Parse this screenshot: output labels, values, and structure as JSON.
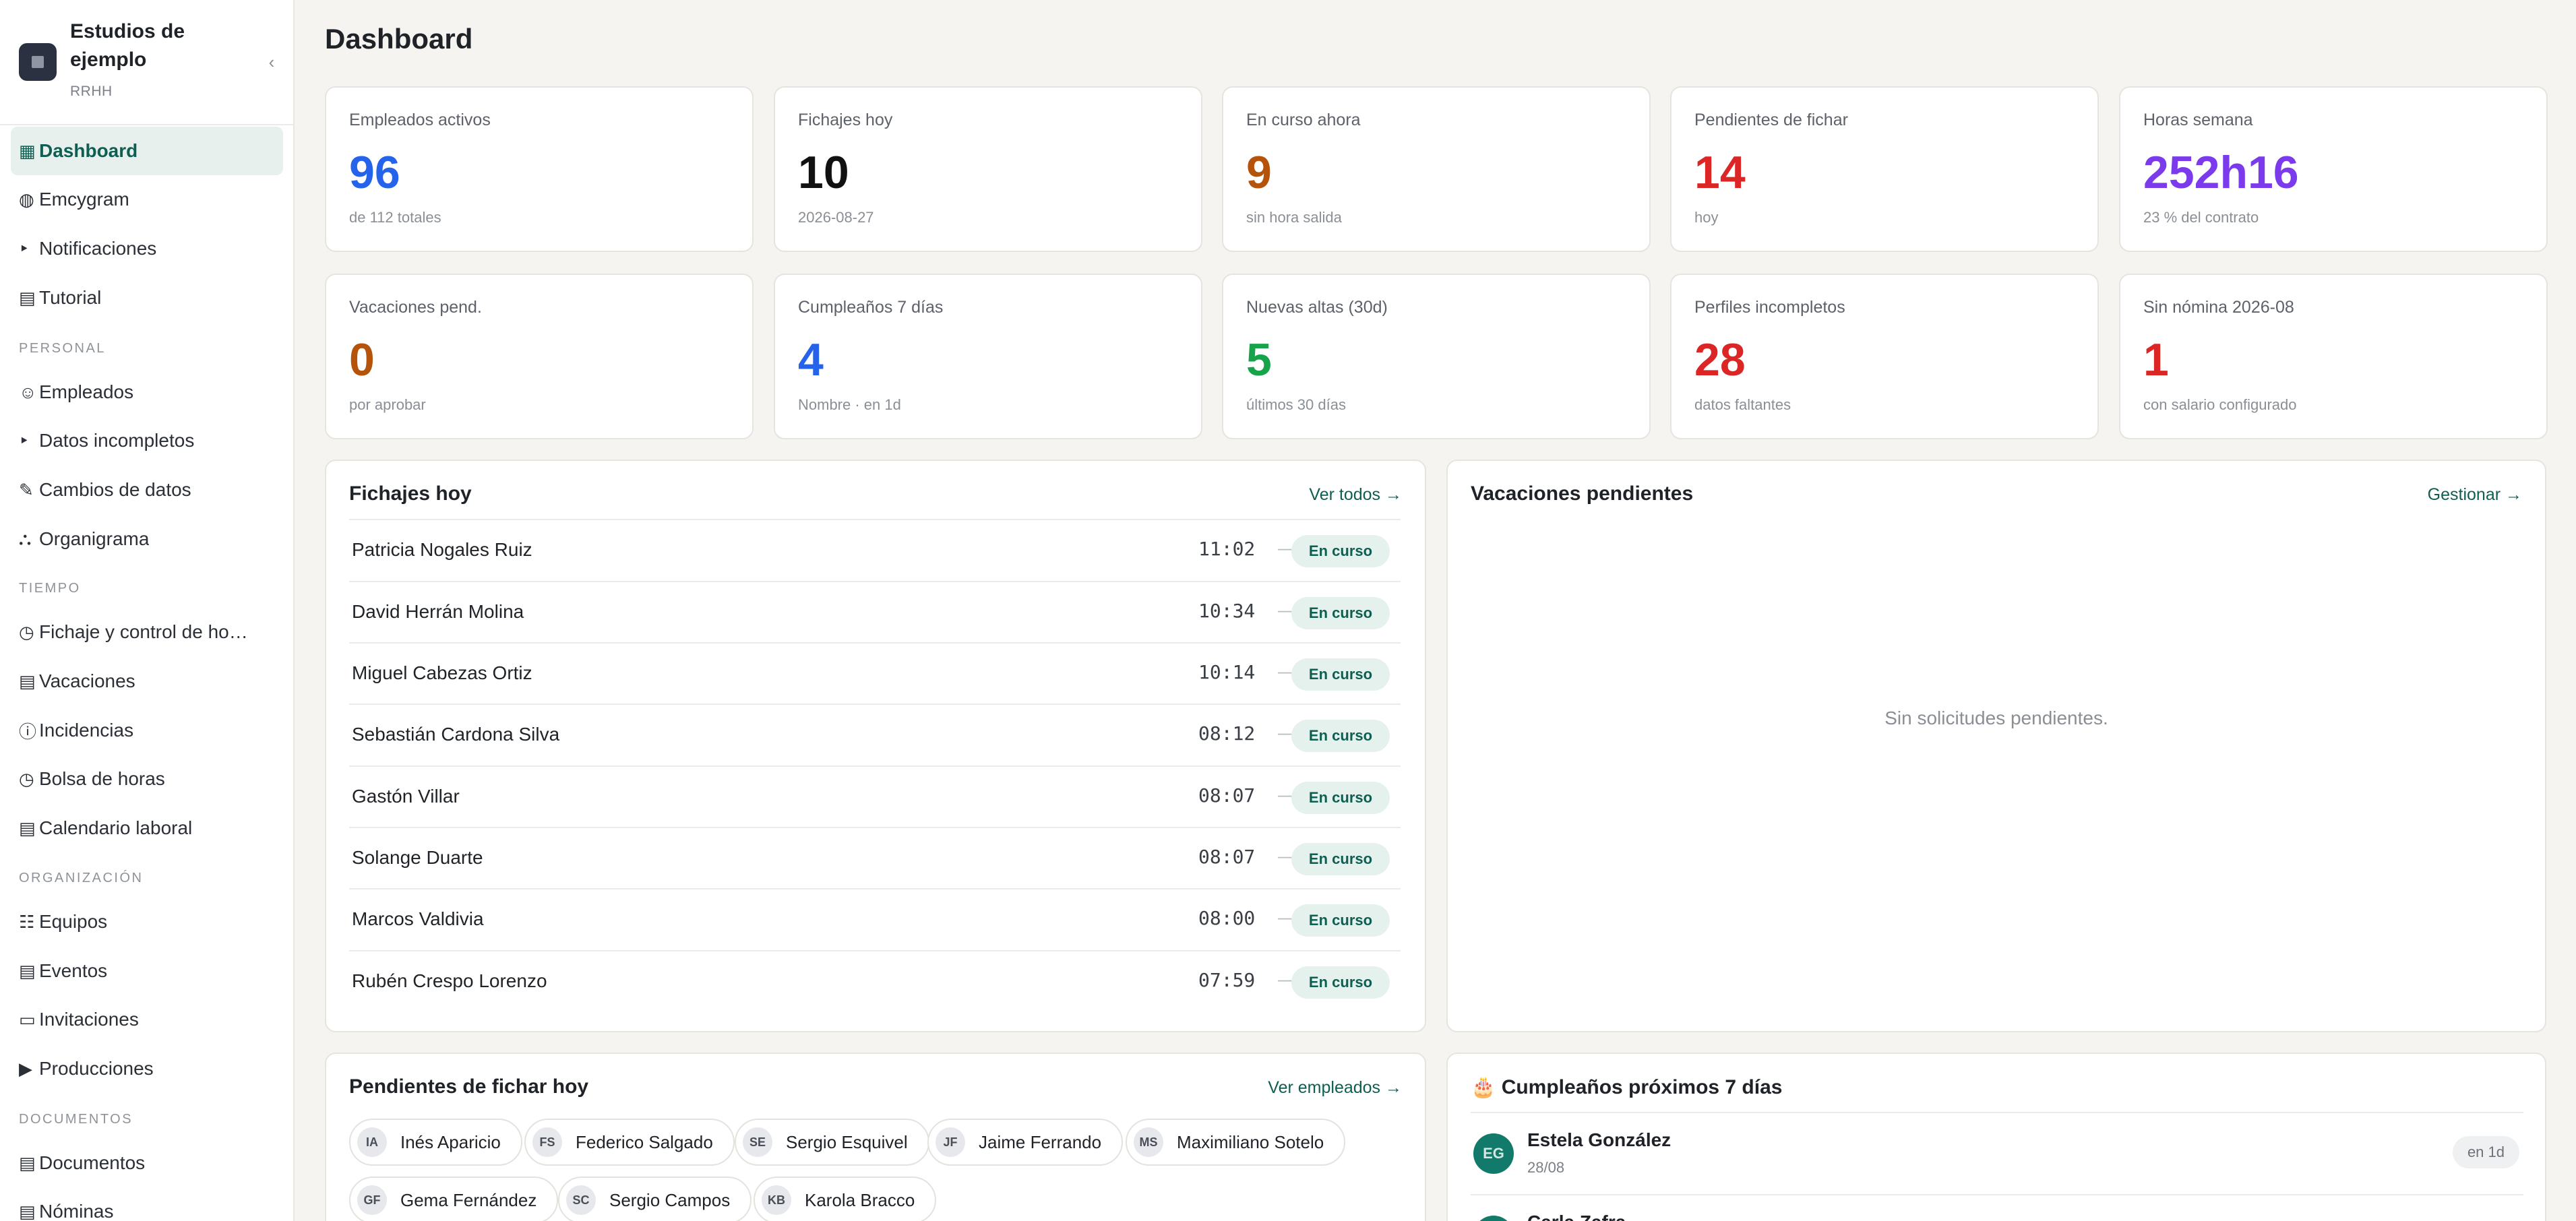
{
  "sidebar": {
    "brand_name": "Estudios de ejemplo",
    "brand_sub": "RRHH",
    "collapse_icon": "chevron-left-icon",
    "items": [
      {
        "icon": "▦",
        "icon_name": "grid-icon",
        "label": "Dashboard",
        "active": true
      },
      {
        "icon": "◍",
        "icon_name": "globe-icon",
        "label": "Emcygram"
      },
      {
        "icon": "‣",
        "icon_name": "bell-icon",
        "label": "Notificaciones"
      },
      {
        "icon": "▤",
        "icon_name": "book-icon",
        "label": "Tutorial"
      }
    ],
    "sections": [
      {
        "title": "PERSONAL",
        "items": [
          {
            "icon": "☺",
            "icon_name": "people-icon",
            "label": "Empleados"
          },
          {
            "icon": "‣",
            "icon_name": "alert-icon",
            "label": "Datos incompletos"
          },
          {
            "icon": "✎",
            "icon_name": "edit-icon",
            "label": "Cambios de datos"
          },
          {
            "icon": "⛬",
            "icon_name": "org-chart-icon",
            "label": "Organigrama"
          }
        ]
      },
      {
        "title": "TIEMPO",
        "items": [
          {
            "icon": "◷",
            "icon_name": "clock-icon",
            "label": "Fichaje y control de ho…"
          },
          {
            "icon": "▤",
            "icon_name": "calendar-icon",
            "label": "Vacaciones"
          },
          {
            "icon": "ⓘ",
            "icon_name": "info-icon",
            "label": "Incidencias"
          },
          {
            "icon": "◷",
            "icon_name": "hour-bank-icon",
            "label": "Bolsa de horas"
          },
          {
            "icon": "▤",
            "icon_name": "work-calendar-icon",
            "label": "Calendario laboral"
          }
        ]
      },
      {
        "title": "ORGANIZACIÓN",
        "items": [
          {
            "icon": "☷",
            "icon_name": "teams-icon",
            "label": "Equipos"
          },
          {
            "icon": "▤",
            "icon_name": "events-icon",
            "label": "Eventos"
          },
          {
            "icon": "▭",
            "icon_name": "invitation-icon",
            "label": "Invitaciones"
          },
          {
            "icon": "▶",
            "icon_name": "play-icon",
            "label": "Producciones"
          }
        ]
      },
      {
        "title": "DOCUMENTOS",
        "items": [
          {
            "icon": "▤",
            "icon_name": "document-icon",
            "label": "Documentos"
          },
          {
            "icon": "▤",
            "icon_name": "payroll-icon",
            "label": "Nóminas"
          }
        ]
      }
    ]
  },
  "page": {
    "title": "Dashboard"
  },
  "stats": [
    {
      "label": "Empleados activos",
      "value": "96",
      "sub": "de 112 totales",
      "color": "#2563eb"
    },
    {
      "label": "Fichajes hoy",
      "value": "10",
      "sub": "2026-08-27",
      "color": "#111111"
    },
    {
      "label": "En curso ahora",
      "value": "9",
      "sub": "sin hora salida",
      "color": "#b45309"
    },
    {
      "label": "Pendientes de fichar",
      "value": "14",
      "sub": "hoy",
      "color": "#dc2626"
    },
    {
      "label": "Horas semana",
      "value": "252h16",
      "sub": "23 % del contrato",
      "color": "#7c3aed"
    },
    {
      "label": "Vacaciones pend.",
      "value": "0",
      "sub": "por aprobar",
      "color": "#b45309"
    },
    {
      "label": "Cumpleaños 7 días",
      "value": "4",
      "sub": "Nombre · en 1d",
      "color": "#2563eb"
    },
    {
      "label": "Nuevas altas (30d)",
      "value": "5",
      "sub": "últimos 30 días",
      "color": "#16a34a"
    },
    {
      "label": "Perfiles incompletos",
      "value": "28",
      "sub": "datos faltantes",
      "color": "#dc2626"
    },
    {
      "label": "Sin nómina 2026-08",
      "value": "1",
      "sub": "con salario configurado",
      "color": "#dc2626"
    }
  ],
  "fichajes": {
    "title": "Fichajes hoy",
    "link": "Ver todos →",
    "dash": "—",
    "rows": [
      {
        "name": "Patricia Nogales Ruiz",
        "time": "11:02",
        "status": "En curso"
      },
      {
        "name": "David Herrán Molina",
        "time": "10:34",
        "status": "En curso"
      },
      {
        "name": "Miguel Cabezas Ortiz",
        "time": "10:14",
        "status": "En curso"
      },
      {
        "name": "Sebastián Cardona Silva",
        "time": "08:12",
        "status": "En curso"
      },
      {
        "name": "Gastón Villar",
        "time": "08:07",
        "status": "En curso"
      },
      {
        "name": "Solange Duarte",
        "time": "08:07",
        "status": "En curso"
      },
      {
        "name": "Marcos Valdivia",
        "time": "08:00",
        "status": "En curso"
      },
      {
        "name": "Rubén Crespo Lorenzo",
        "time": "07:59",
        "status": "En curso"
      }
    ]
  },
  "vacaciones": {
    "title": "Vacaciones pendientes",
    "link": "Gestionar →",
    "empty": "Sin solicitudes pendientes."
  },
  "pendientes": {
    "title": "Pendientes de fichar hoy",
    "link": "Ver empleados →",
    "chips": [
      {
        "initials": "IA",
        "name": "Inés Aparicio"
      },
      {
        "initials": "FS",
        "name": "Federico Salgado"
      },
      {
        "initials": "SE",
        "name": "Sergio Esquivel"
      },
      {
        "initials": "JF",
        "name": "Jaime Ferrando"
      },
      {
        "initials": "MS",
        "name": "Maximiliano Sotelo"
      },
      {
        "initials": "GF",
        "name": "Gema Fernández"
      },
      {
        "initials": "SC",
        "name": "Sergio Campos"
      },
      {
        "initials": "KB",
        "name": "Karola Bracco"
      }
    ]
  },
  "cumpleanos": {
    "title": "🎂 Cumpleaños próximos 7 días",
    "rows": [
      {
        "initials": "EG",
        "name": "Estela González",
        "date": "28/08",
        "badge": "en 1d"
      },
      {
        "initials": "CZ",
        "name": "Carla Zafra",
        "date": "",
        "badge": ""
      }
    ]
  }
}
